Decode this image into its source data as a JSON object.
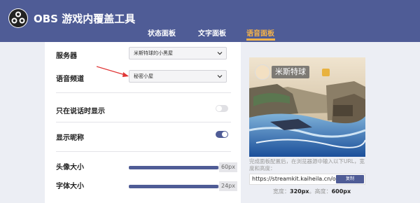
{
  "app": {
    "title": "OBS 游戏内覆盖工具"
  },
  "tabs": [
    {
      "label": "状态面板"
    },
    {
      "label": "文字面板"
    },
    {
      "label": "语音面板"
    }
  ],
  "active_tab": "语音面板",
  "settings": {
    "server": {
      "label": "服务器",
      "value": "米斯特球的小黑屋"
    },
    "channel": {
      "label": "语音频道",
      "value": "秘密小屋"
    },
    "speaking_only": {
      "label": "只在说话时显示",
      "enabled": false
    },
    "show_nickname": {
      "label": "显示昵称",
      "enabled": true
    },
    "avatar_size": {
      "label": "头像大小",
      "value": "60px",
      "fraction": 0.96
    },
    "font_size": {
      "label": "字体大小",
      "value": "24px",
      "fraction": 0.96
    }
  },
  "preview": {
    "username": "米斯特球",
    "info_text": "完成面板配置后，在浏览器源中输入以下URL，宽度和高度：",
    "url": "https://streamkit.kaiheila.cn/ove",
    "copy_label": "复制",
    "width_label": "宽度：",
    "width_value": "320px",
    "height_label": "。高度：",
    "height_value": "600px"
  },
  "colors": {
    "header": "#4f5c96",
    "accent": "#f4b24a",
    "arrow": "#e03535"
  }
}
